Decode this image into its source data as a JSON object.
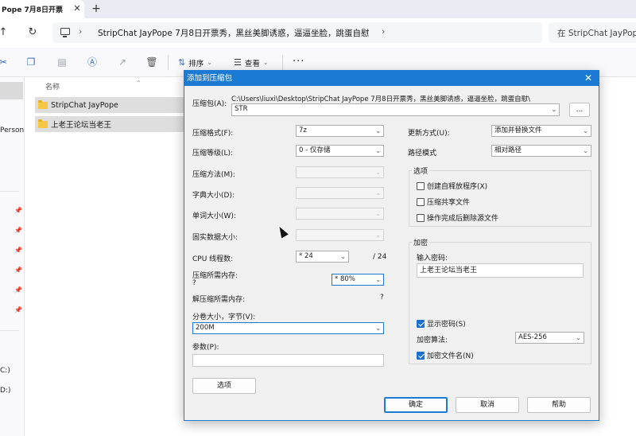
{
  "explorer": {
    "tab_title": "Pope 7月8日开票",
    "tab_close": "✕",
    "new_tab": "+",
    "nav": {
      "up": "↑",
      "refresh": "↻"
    },
    "address": {
      "separator": "›",
      "path": "StripChat JayPope 7月8日开票秀，黑丝美脚诱惑，逼逼坐脸，跳蛋自慰",
      "trail_chevron": "›"
    },
    "search_placeholder": "在 StripChat JayPope",
    "commands": {
      "sort": "排序",
      "view": "查看",
      "more": "···"
    },
    "nav_pane": {
      "items": [
        "Person",
        "C:)",
        "D:)"
      ]
    },
    "column_name": "名称",
    "files": [
      {
        "name": "StripChat JayPope"
      },
      {
        "name": "上老王论坛当老王"
      }
    ]
  },
  "dialog": {
    "title": "添加到压缩包",
    "close": "✕",
    "archive": {
      "label": "压缩包(A):",
      "folder_path": "C:\\Users\\liuxi\\Desktop\\StripChat JayPope 7月8日开票秀，黑丝美脚诱惑，逼逼坐脸，跳蛋自慰\\",
      "name": "STR",
      "browse_label": "..."
    },
    "left": {
      "format": {
        "label": "压缩格式(F):",
        "value": "7z"
      },
      "level": {
        "label": "压缩等级(L):",
        "value": "0 - 仅存储"
      },
      "method": {
        "label": "压缩方法(M):"
      },
      "dict_size": {
        "label": "字典大小(D):"
      },
      "word_size": {
        "label": "单词大小(W):"
      },
      "solid_size": {
        "label": "固实数据大小:"
      },
      "threads": {
        "label": "CPU 线程数:",
        "value": "* 24",
        "max": "/ 24"
      },
      "mem_compress": {
        "label": "压缩所需内存:",
        "value": "?",
        "limit": "* 80%"
      },
      "mem_decompress": {
        "label": "解压缩所需内存:",
        "value": "?"
      },
      "split": {
        "label": "分卷大小，字节(V):",
        "value": "200M"
      },
      "params": {
        "label": "参数(P):",
        "value": ""
      },
      "options_button": "选项"
    },
    "right": {
      "update": {
        "label": "更新方式(U):",
        "value": "添加并替换文件"
      },
      "path_mode": {
        "label": "路径模式",
        "value": "相对路径"
      },
      "options_group": {
        "title": "选项",
        "items": [
          {
            "label": "创建自释放程序(X)",
            "checked": false
          },
          {
            "label": "压缩共享文件",
            "checked": false
          },
          {
            "label": "操作完成后删除源文件",
            "checked": false
          }
        ]
      },
      "encryption": {
        "title": "加密",
        "password_label": "输入密码:",
        "password_value": "上老王论坛当老王",
        "show_password": {
          "label": "显示密码(S)",
          "checked": true
        },
        "method_label": "加密算法:",
        "method_value": "AES-256",
        "encrypt_names": {
          "label": "加密文件名(N)",
          "checked": true
        }
      }
    },
    "buttons": {
      "ok": "确定",
      "cancel": "取消",
      "help": "帮助"
    }
  }
}
